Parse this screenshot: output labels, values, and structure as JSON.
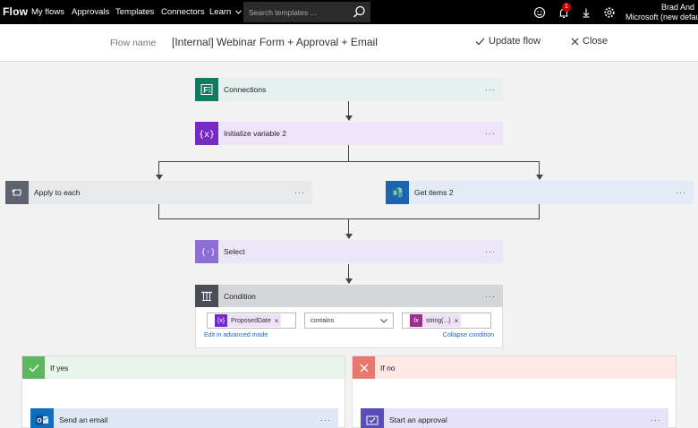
{
  "topbar": {
    "brand": "Flow",
    "nav": [
      "My flows",
      "Approvals",
      "Templates",
      "Connectors",
      "Learn"
    ],
    "search_placeholder": "Search templates ...",
    "notification_count": "1",
    "user_name": "Brad And",
    "user_tenant": "Microsoft (new defau"
  },
  "header": {
    "flow_name_label": "Flow name",
    "flow_name": "[Internal] Webinar Form + Approval + Email",
    "update_label": "Update flow",
    "close_label": "Close"
  },
  "steps": {
    "connections": "Connections",
    "init_var": "Initialize variable 2",
    "apply_each": "Apply to each",
    "get_items": "Get items 2",
    "select": "Select",
    "condition": "Condition",
    "more": "···"
  },
  "condition": {
    "left_token": "ProposedDate",
    "left_token_icon": "{x}",
    "operator": "contains",
    "right_token": "string(...)",
    "right_token_icon": "fx",
    "remove": "×",
    "edit_advanced": "Edit in advanced mode",
    "collapse": "Collapse condition"
  },
  "branches": {
    "yes_label": "If yes",
    "no_label": "If no",
    "send_email": "Send an email",
    "start_approval": "Start an approval"
  },
  "colors": {
    "forms": "#0f7b5f",
    "variable": "#7729c4",
    "loop": "#5d6470",
    "sharepoint": "#1d63b3",
    "condition": "#484f58",
    "yes": "#5cb85c",
    "no": "#e8786e",
    "outlook": "#0f6fbf",
    "approval": "#5a4db8"
  }
}
